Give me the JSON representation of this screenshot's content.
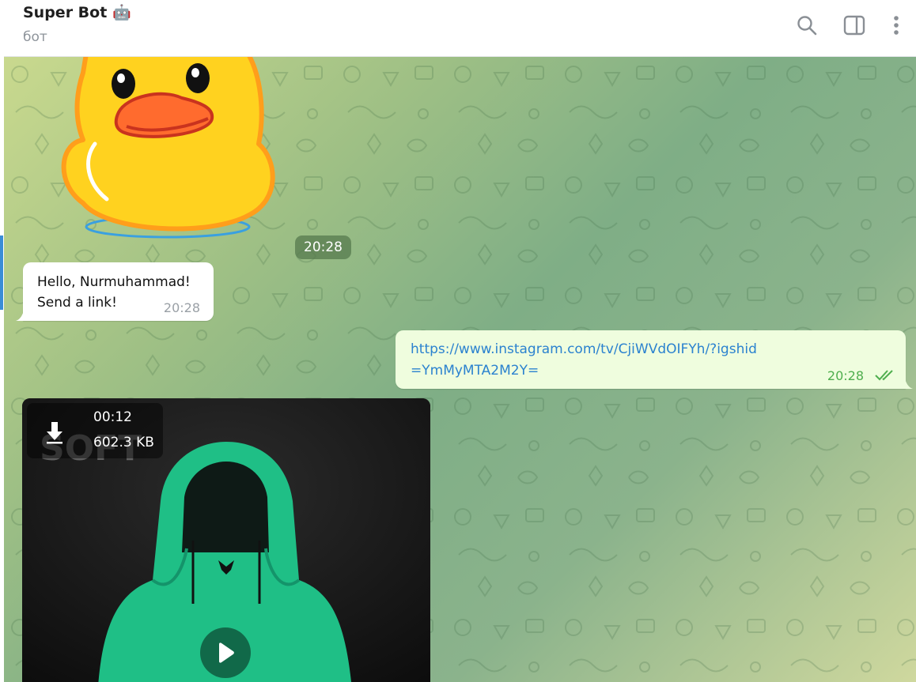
{
  "header": {
    "title": "Super Bot",
    "title_emoji": "🤖",
    "subtitle": "бот",
    "icons": [
      "search-icon",
      "sidebar-toggle-icon",
      "more-vertical-icon"
    ]
  },
  "messages": {
    "sticker": {
      "icon": "duck-sticker",
      "time": "20:28"
    },
    "bot_greeting": {
      "text": "Hello, Nurmuhammad!\nSend a link!",
      "time": "20:28"
    },
    "user_link": {
      "text": "https://www.instagram.com/tv/CjiWVdOIFYh/?igshid=YmMyMTA2M2Y=",
      "time": "20:28",
      "status": "read"
    },
    "video": {
      "duration": "00:12",
      "size": "602.3 KB",
      "watermark": "SOFT",
      "icons": [
        "download-icon",
        "play-icon"
      ]
    }
  },
  "colors": {
    "accent": "#3a8dd6",
    "link": "#2b82cf",
    "outgoing_bubble": "#effdde",
    "outgoing_time": "#4fae4e",
    "hoodie": "#1fbf86"
  }
}
